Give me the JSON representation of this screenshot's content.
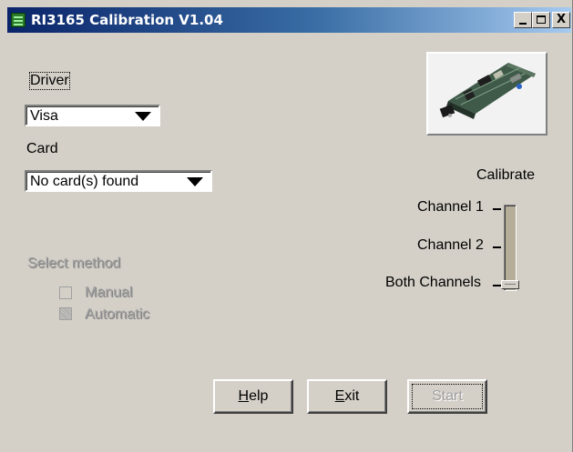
{
  "window": {
    "title": "RI3165 Calibration V1.04",
    "controls": {
      "minimize": "_",
      "maximize": "□",
      "close": "X"
    }
  },
  "driver": {
    "label": "Driver",
    "selected": "Visa"
  },
  "card": {
    "label": "Card",
    "selected": "No card(s) found"
  },
  "calibrate": {
    "label": "Calibrate",
    "options": [
      "Channel 1",
      "Channel 2",
      "Both Channels"
    ],
    "selected": "Both Channels"
  },
  "select_method": {
    "label": "Select method",
    "options": [
      "Manual",
      "Automatic"
    ],
    "enabled": false
  },
  "buttons": {
    "help": {
      "accel": "H",
      "rest": "elp"
    },
    "exit": {
      "accel": "E",
      "rest": "xit"
    },
    "start": {
      "label": "Start",
      "enabled": false
    }
  },
  "icons": {
    "app": "circuit-board-icon",
    "card_image": "pci-card-image"
  },
  "colors": {
    "title_gradient_start": "#0a246a",
    "title_gradient_end": "#a6caf0",
    "window_bg": "#d4d0c8",
    "disabled_text": "#a0a0a0"
  }
}
